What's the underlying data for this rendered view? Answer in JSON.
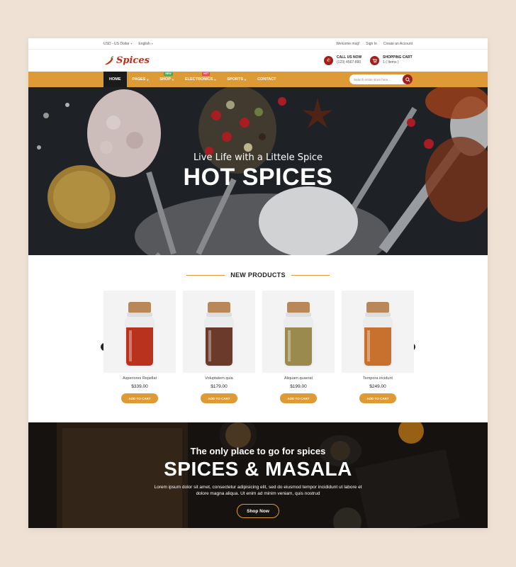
{
  "topbar": {
    "currency": "USD - US Dollar",
    "language": "English",
    "welcome": "Welcome msg!",
    "sign_in": "Sign In",
    "create_account": "Create an Account"
  },
  "header": {
    "logo_text": "Spices",
    "call_title": "CALL US NOW",
    "call_number": "(123) 4567-890",
    "cart_title": "SHOPPING CART",
    "cart_items": "1 ( Items )"
  },
  "nav": {
    "items": [
      {
        "label": "HOME"
      },
      {
        "label": "PAGES"
      },
      {
        "label": "SHOP",
        "badge": "NEW"
      },
      {
        "label": "ELECTRONICS",
        "badge": "HOT"
      },
      {
        "label": "SPORTS"
      },
      {
        "label": "CONTACT"
      }
    ],
    "search_placeholder": "Search entire store here..."
  },
  "hero": {
    "subtitle": "Live Life with a Littele Spice",
    "title": "HOT SPICES"
  },
  "products": {
    "section_title": "NEW PRODUCTS",
    "items": [
      {
        "name": "Asperiores Repellat",
        "price": "$339.00",
        "button": "ADD TO CART",
        "fill_color": "#b8321e"
      },
      {
        "name": "Voluptatem quia",
        "price": "$179.00",
        "button": "ADD TO CART",
        "fill_color": "#6b3a2a"
      },
      {
        "name": "Aliquam quaerat",
        "price": "$199.00",
        "button": "ADD TO CART",
        "fill_color": "#9a8a4e"
      },
      {
        "name": "Tempora incidunt",
        "price": "$249.00",
        "button": "ADD TO CART",
        "fill_color": "#c8702e"
      }
    ]
  },
  "promo": {
    "subtitle": "The only place to go for spices",
    "title": "SPICES & MASALA",
    "description": "Lorem ipsum dolor sit amet, consectetur adipisicing elit, sed do eiusmod tempor incididunt ut labore et dolore magna aliqua. Ut enim ad minim veniam, quis nostrud",
    "button": "Shop Now"
  },
  "colors": {
    "accent": "#dd9a35",
    "brand_red": "#a3201a"
  }
}
